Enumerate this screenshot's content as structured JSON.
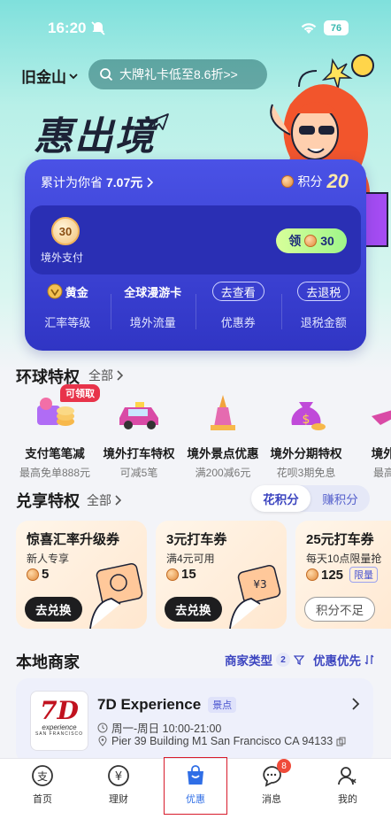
{
  "status_bar": {
    "time": "16:20",
    "battery": "76"
  },
  "header": {
    "city": "旧金山",
    "search_placeholder": "大牌礼卡低至8.6折>>"
  },
  "hero": {
    "title": "惠出境"
  },
  "card": {
    "savings_text": "累计为你省",
    "savings_amount": "7.07元",
    "points_label": "积分",
    "points_value": "20",
    "coin_badge": "30",
    "coin_label": "境外支付",
    "claim_label": "领",
    "claim_value": "30",
    "stats": [
      {
        "top": "黄金",
        "bottom": "汇率等级"
      },
      {
        "top": "全球漫游卡",
        "bottom": "境外流量"
      },
      {
        "top": "去查看",
        "bottom": "优惠券"
      },
      {
        "top": "去退税",
        "bottom": "退税金额"
      }
    ]
  },
  "global_privileges": {
    "title": "环球特权",
    "more": "全部",
    "tag": "可领取",
    "items": [
      {
        "name": "支付笔笔减",
        "desc": "最高免单888元"
      },
      {
        "name": "境外打车特权",
        "desc": "可减5笔"
      },
      {
        "name": "境外景点优惠",
        "desc": "满200减6元"
      },
      {
        "name": "境外分期特权",
        "desc": "花呗3期免息"
      },
      {
        "name": "境外机",
        "desc": "最高立"
      }
    ]
  },
  "exchange": {
    "title": "兑享特权",
    "more": "全部",
    "tabs": [
      "花积分",
      "赚积分"
    ],
    "coupons": [
      {
        "title": "惊喜汇率升级券",
        "sub": "新人专享",
        "cost": "5",
        "limit": "",
        "button": "去兑换",
        "disabled": false
      },
      {
        "title": "3元打车券",
        "sub": "满4元可用",
        "cost": "15",
        "limit": "",
        "button": "去兑换",
        "disabled": false
      },
      {
        "title": "25元打车券",
        "sub": "每天10点限量抢",
        "cost": "125",
        "limit": "限量",
        "button": "积分不足",
        "disabled": true
      }
    ]
  },
  "merchants": {
    "title": "本地商家",
    "filter_type": "商家类型",
    "filter_count": "2",
    "filter_sort": "优惠优先",
    "item": {
      "logo_main": "7D",
      "logo_sub": "experience",
      "logo_city": "SAN FRANCISCO",
      "name": "7D Experience",
      "tag": "景点",
      "hours": "周一-周日 10:00-21:00",
      "address": "Pier 39 Building M1 San Francisco CA 94133"
    }
  },
  "bottom_nav": {
    "items": [
      "首页",
      "理财",
      "优惠",
      "消息",
      "我的"
    ],
    "message_badge": "8",
    "active_color": "#2f6ee6"
  }
}
